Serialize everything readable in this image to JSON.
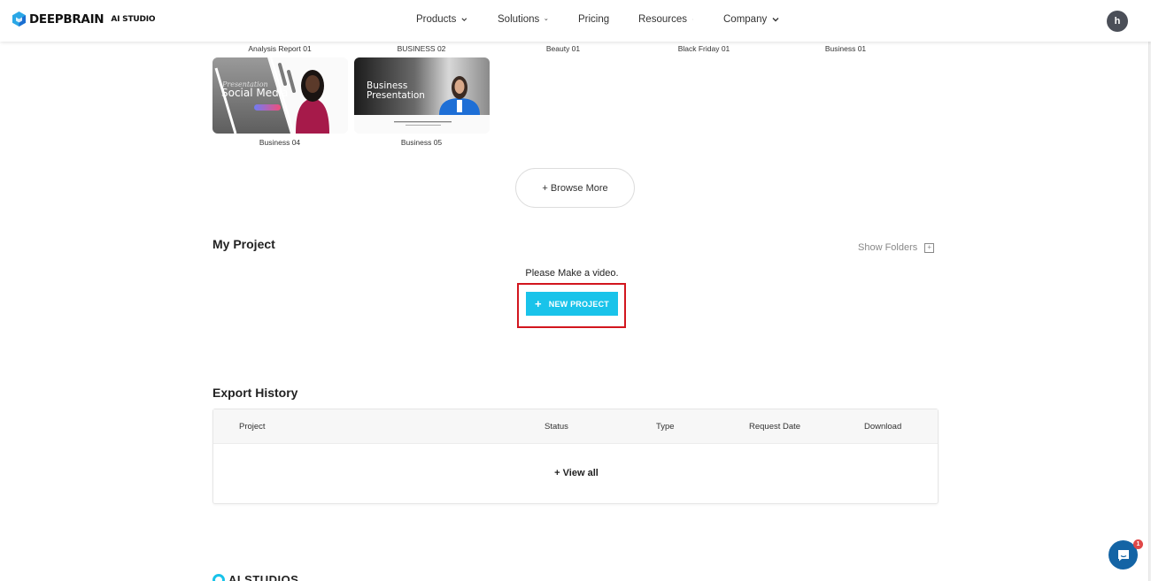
{
  "header": {
    "brand": "DEEPBRAIN",
    "brand_sub": "AI STUDIO",
    "nav": [
      {
        "label": "Products",
        "has_dropdown": true
      },
      {
        "label": "Solutions",
        "has_dropdown": true
      },
      {
        "label": "Pricing",
        "has_dropdown": false
      },
      {
        "label": "Resources",
        "has_dropdown": true
      },
      {
        "label": "Company",
        "has_dropdown": true
      }
    ],
    "avatar_initial": "h"
  },
  "templates": {
    "row1_captions": [
      "Analysis Report 01",
      "BUSINESS 02",
      "Beauty 01",
      "Black Friday 01",
      "Business 01"
    ],
    "row2": [
      {
        "caption": "Business 04",
        "thumb_title_script": "Presentation",
        "thumb_title": "Social Media"
      },
      {
        "caption": "Business 05",
        "thumb_title": "Business",
        "thumb_title2": "Presentation"
      }
    ],
    "browse_more": "+ Browse More"
  },
  "my_project": {
    "title": "My Project",
    "show_folders": "Show Folders",
    "empty_message": "Please Make a video.",
    "new_project": "NEW PROJECT"
  },
  "export_history": {
    "title": "Export History",
    "columns": [
      "Project",
      "Status",
      "Type",
      "Request Date",
      "Download"
    ],
    "view_all": "+ View all"
  },
  "footer": {
    "logo_text": "AI STUDIOS"
  },
  "chat": {
    "badge_count": "1"
  },
  "colors": {
    "accent": "#19c3ea",
    "highlight": "#d2161e",
    "chat": "#1464a5"
  }
}
